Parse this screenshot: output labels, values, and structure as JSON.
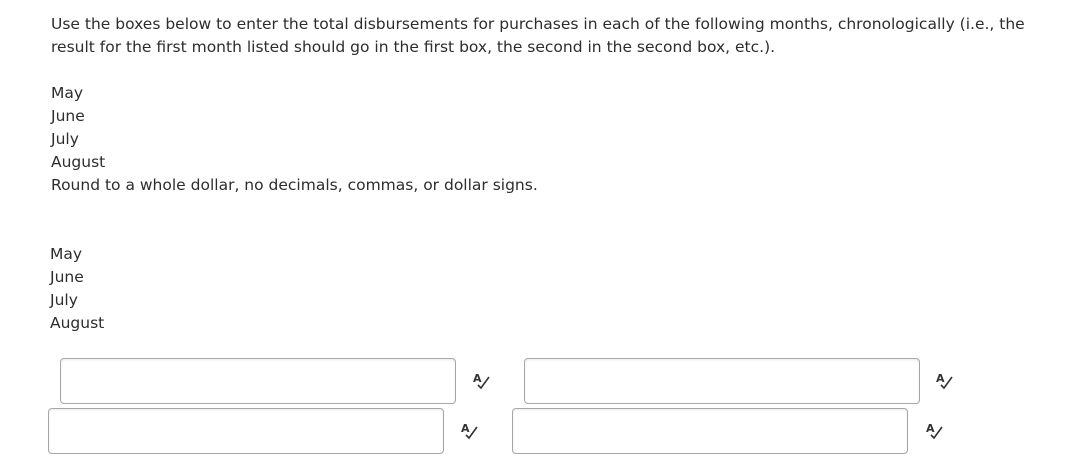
{
  "instructions": "Use the boxes below to enter the total disbursements for purchases in each of the following months, chronologically (i.e., the result for the first month listed should go in the first box, the second in the second box, etc.).",
  "months_list_1": [
    "May",
    "June",
    "July",
    "August"
  ],
  "rounding_note": "Round to a whole dollar, no decimals, commas, or dollar signs.",
  "months_list_2": [
    "May",
    "June",
    "July",
    "August"
  ],
  "answer_boxes": [
    {
      "value": "",
      "icon": "spell-check-icon"
    },
    {
      "value": "",
      "icon": "spell-check-icon"
    },
    {
      "value": "",
      "icon": "spell-check-icon"
    },
    {
      "value": "",
      "icon": "spell-check-icon"
    }
  ]
}
